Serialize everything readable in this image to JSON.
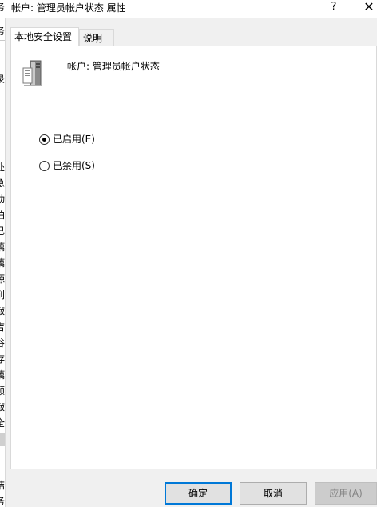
{
  "window": {
    "title": "帐户: 管理员帐户状态 属性",
    "help_label": "?",
    "close_label": "✕"
  },
  "background_chars": [
    "务",
    "务",
    "录",
    "处",
    "急",
    "动",
    "拍",
    "已",
    "藕",
    "藕",
    "源",
    "削",
    "敲",
    "吉",
    "谷",
    "存",
    "藕",
    "顾",
    "敲",
    "全",
    "结",
    "务"
  ],
  "tabs": [
    {
      "label": "本地安全设置",
      "active": true
    },
    {
      "label": "说明",
      "active": false
    }
  ],
  "policy": {
    "icon": "server-computer-icon",
    "name": "帐户: 管理员帐户状态"
  },
  "options": [
    {
      "label": "已启用(E)",
      "checked": true
    },
    {
      "label": "已禁用(S)",
      "checked": false
    }
  ],
  "buttons": {
    "ok": "确定",
    "cancel": "取消",
    "apply": "应用(A)"
  },
  "colors": {
    "accent": "#0078d7",
    "dialog_bg": "#f0f0f0",
    "panel_bg": "#ffffff"
  }
}
